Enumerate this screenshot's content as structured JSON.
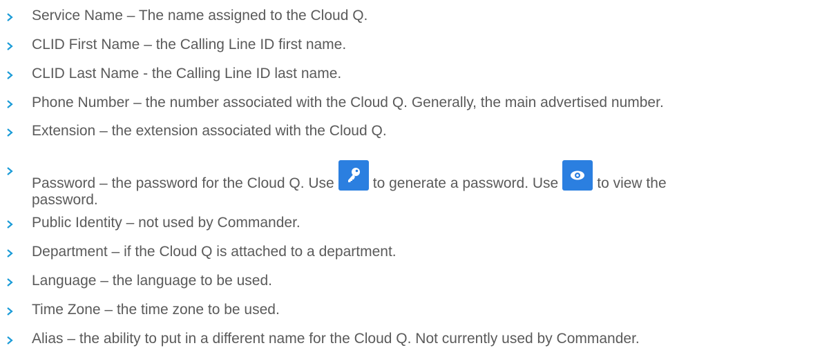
{
  "items": [
    {
      "label": "Service Name",
      "sep": " – ",
      "desc": "The name assigned to the Cloud Q."
    },
    {
      "label": "CLID First Name",
      "sep": " – ",
      "desc": "the Calling Line ID first name."
    },
    {
      "label": "CLID Last Name",
      "sep": " - ",
      "desc": "the Calling Line ID last name."
    },
    {
      "label": "Phone Number",
      "sep": " – ",
      "desc": "the number associated with the Cloud Q. Generally, the main advertised number."
    },
    {
      "label": "Extension",
      "sep": " – ",
      "desc": "the extension associated with the Cloud Q."
    },
    {
      "label": "Password",
      "sep": " – ",
      "desc_part1": "the password for the Cloud Q. Use",
      "desc_part2": "to generate a password. Use",
      "desc_part3": "to view the",
      "desc_part4": "password."
    },
    {
      "label": "Public Identity",
      "sep": " – ",
      "desc": "not used by Commander."
    },
    {
      "label": "Department",
      "sep": " – ",
      "desc": "if the Cloud Q is attached to a department."
    },
    {
      "label": "Language",
      "sep": " – ",
      "desc": "the language to be used."
    },
    {
      "label": "Time Zone",
      "sep": " – ",
      "desc": "the time zone to be used."
    },
    {
      "label": "Alias",
      "sep": " – ",
      "desc": "the ability to put in a different name for the Cloud Q. Not currently used by Commander."
    }
  ],
  "icons": {
    "generate_password": "key-icon",
    "view_password": "eye-icon",
    "bullet": "chevron-right-icon",
    "button_color": "#2b7fe0",
    "bullet_color": "#1a9bd7",
    "text_color": "#5a5a5a"
  }
}
